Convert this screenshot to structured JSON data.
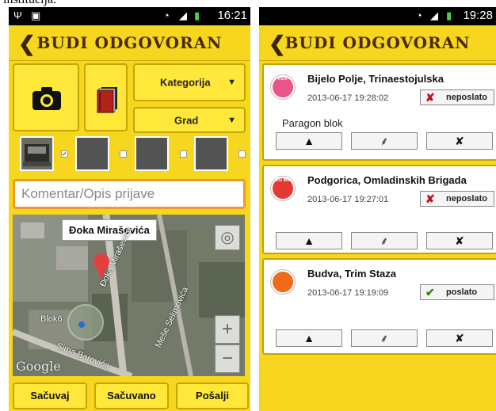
{
  "page": {
    "top_text": "institucija."
  },
  "left_phone": {
    "status": {
      "time": "16:21"
    },
    "header": {
      "back_icon": "chevron-left-icon",
      "title": "BUDI ODGOVORAN"
    },
    "photo_button": {
      "icon": "camera-icon"
    },
    "gallery_button": {
      "icon": "book-icon"
    },
    "category_select": {
      "label": "Kategorija"
    },
    "city_select": {
      "label": "Grad"
    },
    "comment": {
      "placeholder": "Komentar/Opis prijave"
    },
    "map": {
      "marker_label": "Đoka Miraševića",
      "labels": [
        "Đoka Miraševića",
        "Meše Selimovića",
        "Blok6",
        "Sima Barovića"
      ],
      "attribution": "Google"
    },
    "buttons": {
      "save": "Sačuvaj",
      "saved": "Sačuvano",
      "send": "Pošalji"
    }
  },
  "right_phone": {
    "status": {
      "time": "19:28"
    },
    "header": {
      "title": "BUDI ODGOVORAN"
    },
    "reports": [
      {
        "title": "Bijelo Polje, Trinaestojulska",
        "timestamp": "2013-06-17 19:28:02",
        "status": "neposlato",
        "status_color": "#c0101a",
        "note": "Paragon blok",
        "badge": "PDV",
        "badge_color": "#e9558a"
      },
      {
        "title": "Podgorica, Omladinskih Brigada",
        "timestamp": "2013-06-17 19:27:01",
        "status": "neposlato",
        "status_color": "#c0101a",
        "note": "",
        "badge": "CG MN",
        "badge_color": "#e33a36"
      },
      {
        "title": "Budva, Trim Staza",
        "timestamp": "2013-06-17 19:19:09",
        "status": "poslato",
        "status_color": "#2a8a12",
        "note": "",
        "badge": "",
        "badge_color": "#f06a1a"
      }
    ]
  }
}
